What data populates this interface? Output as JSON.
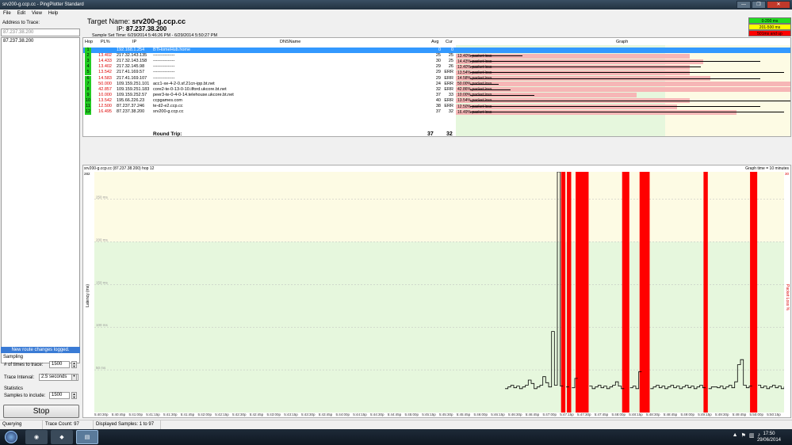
{
  "window": {
    "title": "srv200-g.ccp.cc - PingPlotter Standard",
    "min": "—",
    "max": "❐",
    "close": "✕"
  },
  "menu": [
    "File",
    "Edit",
    "View",
    "Help"
  ],
  "left": {
    "address_label": "Address to Trace:",
    "address_placeholder": "87.237.38.200",
    "history": [
      "87.237.38.200"
    ],
    "route_banner": "New route changes logged.",
    "sampling_label": "Sampling",
    "times_label": "# of times to trace:",
    "times_value": "1500",
    "interval_label": "Trace Interval:",
    "interval_value": "2.5 seconds",
    "statistics_label": "Statistics",
    "samples_label": "Samples to include:",
    "samples_value": "1500",
    "stop_label": "Stop"
  },
  "header": {
    "target_label": "Target Name:",
    "target_value": "srv200-g.ccp.cc",
    "ip_label": "IP:",
    "ip_value": "87.237.38.200",
    "sample_time": "Sample Set Time: 6/29/2014 5:46:26 PM - 6/29/2014 5:50:27 PM"
  },
  "legend": [
    {
      "label": "0-200 ms",
      "color": "#22dd22"
    },
    {
      "label": "201-500 ms",
      "color": "#ffff00"
    },
    {
      "label": "501ms and up",
      "color": "#ff0000"
    }
  ],
  "columns": {
    "hop": "Hop",
    "pl": "PL%",
    "ip": "IP",
    "dns": "DNSName",
    "avg": "Avg",
    "cur": "Cur",
    "graph": "Graph"
  },
  "hops": [
    {
      "hop": "1",
      "pl": "",
      "ip": "192.168.1.254",
      "dns": "BTHomeHub.home",
      "avg": "0",
      "cur": "0",
      "loss": "",
      "loss_frac": 0,
      "range": [
        0,
        0
      ],
      "selected": true
    },
    {
      "hop": "2",
      "pl": "13.402",
      "ip": "217.32.143.135",
      "dns": "---------------",
      "avg": "25",
      "cur": "25",
      "loss": "13.40% packet loss",
      "loss_frac": 0.7,
      "range": [
        18,
        40
      ],
      "selected": false
    },
    {
      "hop": "3",
      "pl": "14.433",
      "ip": "217.32.143.158",
      "dns": "---------------",
      "avg": "30",
      "cur": "25",
      "loss": "14.43% packet loss",
      "loss_frac": 0.74,
      "range": [
        18,
        140
      ],
      "selected": false
    },
    {
      "hop": "4",
      "pl": "13.402",
      "ip": "217.32.145.98",
      "dns": "---------------",
      "avg": "29",
      "cur": "26",
      "loss": "13.40% packet loss",
      "loss_frac": 0.7,
      "range": [
        18,
        115
      ],
      "selected": false
    },
    {
      "hop": "5",
      "pl": "13.542",
      "ip": "217.41.169.57",
      "dns": "---------------",
      "avg": "29",
      "cur": "ERR",
      "loss": "13.54% packet loss",
      "loss_frac": 0.7,
      "range": [
        18,
        150
      ],
      "selected": false
    },
    {
      "hop": "6",
      "pl": "14.583",
      "ip": "217.41.169.107",
      "dns": "---------------",
      "avg": "29",
      "cur": "ERR",
      "loss": "14.58% packet loss",
      "loss_frac": 0.76,
      "range": [
        18,
        140
      ],
      "selected": false
    },
    {
      "hop": "7",
      "pl": "50.000",
      "ip": "109.159.251.101",
      "dns": "acc1-xe-4-2-0.sf.21cn-ipp.bt.net",
      "avg": "24",
      "cur": "ERR",
      "loss": "50.00% packet loss",
      "loss_frac": 1.0,
      "range": [
        18,
        30
      ],
      "selected": false
    },
    {
      "hop": "8",
      "pl": "42.857",
      "ip": "109.159.251.183",
      "dns": "core2-te-0-13-0-10.ilford.ukcore.bt.net",
      "avg": "32",
      "cur": "ERR",
      "loss": "42.86% packet loss",
      "loss_frac": 1.0,
      "range": [
        18,
        35
      ],
      "selected": false
    },
    {
      "hop": "9",
      "pl": "10.000",
      "ip": "109.159.252.57",
      "dns": "peer3-te-0-4-0-14.telehouse.ukcore.bt.net",
      "avg": "37",
      "cur": "33",
      "loss": "10.00% packet loss",
      "loss_frac": 0.54,
      "range": [
        18,
        45
      ],
      "selected": false
    },
    {
      "hop": "10",
      "pl": "13.542",
      "ip": "195.66.226.23",
      "dns": "ccpgames.com",
      "avg": "40",
      "cur": "ERR",
      "loss": "13.54% packet loss",
      "loss_frac": 0.7,
      "range": [
        18,
        160
      ],
      "selected": false
    },
    {
      "hop": "11",
      "pl": "12.500",
      "ip": "87.237.37.246",
      "dns": "te-d2-e2.ccp.cc",
      "avg": "38",
      "cur": "ERR",
      "loss": "12.50% packet loss",
      "loss_frac": 0.66,
      "range": [
        18,
        140
      ],
      "selected": false
    },
    {
      "hop": "12",
      "pl": "16.495",
      "ip": "87.237.38.200",
      "dns": "srv200-g.ccp.cc",
      "avg": "37",
      "cur": "32",
      "loss": "16.49% packet loss",
      "loss_frac": 0.84,
      "range": [
        18,
        150
      ],
      "selected": false
    }
  ],
  "roundtrip": {
    "label": "Round Trip:",
    "avg": "37",
    "cur": "32"
  },
  "timegraph": {
    "title": "srv200-g.ccp.cc (87.237.38.200) hop 12",
    "time_label": "Graph time = 10 minutes",
    "ymax_label": "282",
    "y_axis": "Latency (ms)",
    "pl_axis": "Packet Loss %",
    "pl_max": "30",
    "y_ticks": [
      "250 ms",
      "200 ms",
      "150 ms",
      "100 ms",
      "50 ms"
    ],
    "x_ticks": [
      "5:40:30p",
      "5:40:45p",
      "5:41:00p",
      "5:41:15p",
      "5:41:30p",
      "5:41:45p",
      "5:42:00p",
      "5:42:15p",
      "5:42:30p",
      "5:42:45p",
      "5:43:00p",
      "5:43:15p",
      "5:43:30p",
      "5:43:45p",
      "5:44:00p",
      "5:44:15p",
      "5:44:30p",
      "5:44:45p",
      "5:45:00p",
      "5:45:15p",
      "5:45:30p",
      "5:45:45p",
      "5:46:00p",
      "5:46:15p",
      "5:46:30p",
      "5:46:45p",
      "5:47:00p",
      "5:47:15p",
      "5:47:30p",
      "5:47:45p",
      "5:48:00p",
      "5:48:15p",
      "5:48:30p",
      "5:48:45p",
      "5:49:00p",
      "5:49:15p",
      "5:49:30p",
      "5:49:45p",
      "5:50:00p",
      "5:50:15p"
    ]
  },
  "status": {
    "state": "Querying",
    "trace_count": "Trace Count: 97",
    "displayed": "Displayed Samples: 1 to 97"
  },
  "clock": {
    "time": "17:50",
    "date": "29/06/2014"
  },
  "taskbar_apps": [
    "firefox-icon",
    "eve-icon",
    "pingplotter-icon"
  ]
}
